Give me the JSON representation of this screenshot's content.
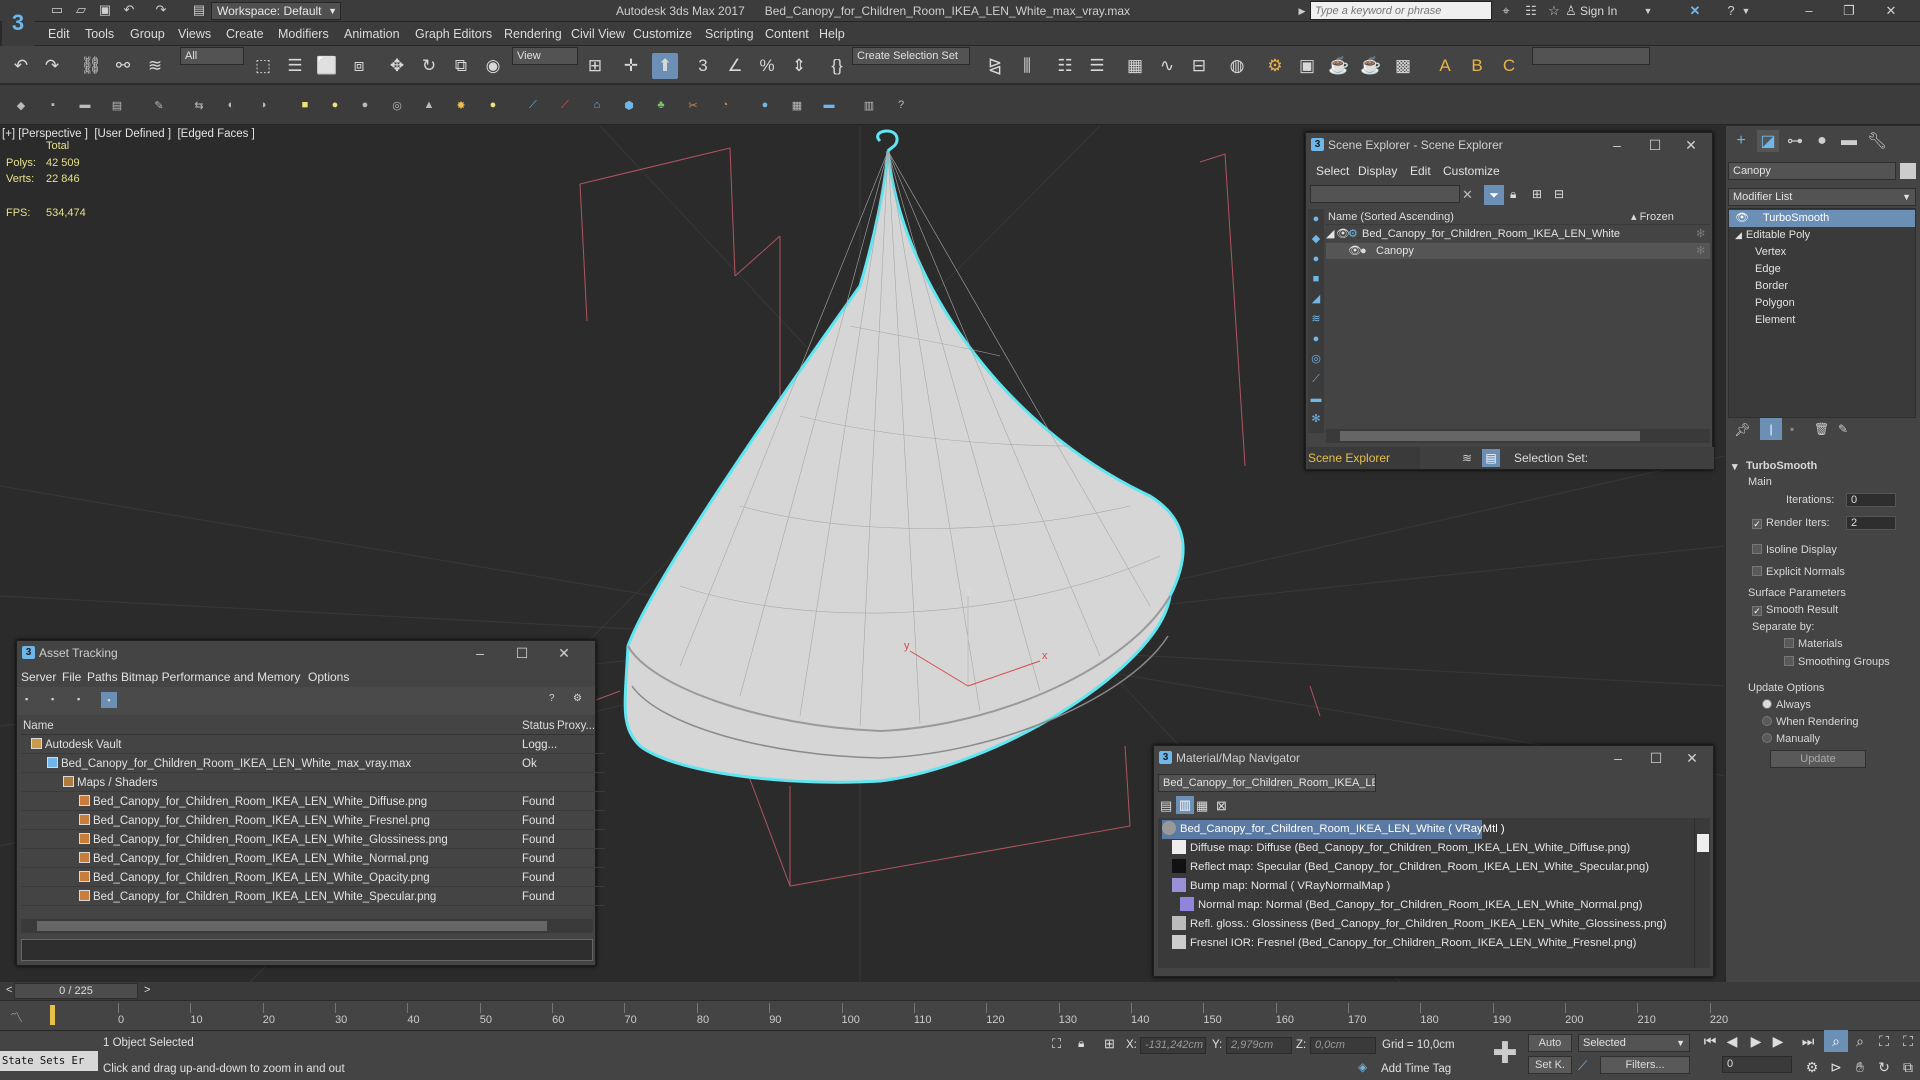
{
  "title_bar": {
    "logo": "3",
    "workspace_label": "Workspace: Default",
    "app_title": "Autodesk 3ds Max 2017      Bed_Canopy_for_Children_Room_IKEA_LEN_White_max_vray.max",
    "search_placeholder": "Type a keyword or phrase",
    "sign_in": "Sign In"
  },
  "menu": [
    "Edit",
    "Tools",
    "Group",
    "Views",
    "Create",
    "Modifiers",
    "Animation",
    "Graph Editors",
    "Rendering",
    "Civil View",
    "Customize",
    "Scripting",
    "Content",
    "Help"
  ],
  "toolbar": {
    "filter_all": "All",
    "ref_coord": "View",
    "selection_set": "Create Selection Set"
  },
  "viewport": {
    "label": "[+] [Perspective ]  [User Defined ]  [Edged Faces ]",
    "stats_total": "Total",
    "polys_label": "Polys:",
    "polys_value": "42 509",
    "verts_label": "Verts:",
    "verts_value": "22 846",
    "fps_label": "FPS:",
    "fps_value": "534,474",
    "axis_x": "x",
    "axis_y": "y",
    "axis_z": "z"
  },
  "scene_explorer": {
    "title": "Scene Explorer - Scene Explorer",
    "menu": [
      "Select",
      "Display",
      "Edit",
      "Customize"
    ],
    "col_name": "Name (Sorted Ascending)",
    "col_frozen": "▴ Frozen",
    "root": "Bed_Canopy_for_Children_Room_IKEA_LEN_White",
    "child": "Canopy",
    "footer_name": "Scene Explorer",
    "selection_set": "Selection Set:"
  },
  "command_panel": {
    "object_name": "Canopy",
    "modifier_list": "Modifier List",
    "stack": [
      "TurboSmooth",
      "Editable Poly",
      "Vertex",
      "Edge",
      "Border",
      "Polygon",
      "Element"
    ],
    "rollout_title": "TurboSmooth",
    "main": "Main",
    "iterations_label": "Iterations:",
    "iterations_value": "0",
    "render_iters_label": "Render Iters:",
    "render_iters_value": "2",
    "isoline": "Isoline Display",
    "explicit_normals": "Explicit Normals",
    "surface_params": "Surface Parameters",
    "smooth_result": "Smooth Result",
    "separate_by": "Separate by:",
    "materials": "Materials",
    "smoothing_groups": "Smoothing Groups",
    "update_options": "Update Options",
    "always": "Always",
    "when_rendering": "When Rendering",
    "manually": "Manually",
    "update_button": "Update"
  },
  "asset_tracking": {
    "title": "Asset Tracking",
    "menu": [
      "Server",
      "File",
      "Paths",
      "Bitmap Performance and Memory",
      "Options"
    ],
    "col_name": "Name",
    "col_status": "Status",
    "col_proxy": "Proxy...",
    "rows": [
      {
        "name": "Autodesk Vault",
        "status": "Logg..."
      },
      {
        "name": "Bed_Canopy_for_Children_Room_IKEA_LEN_White_max_vray.max",
        "status": "Ok"
      },
      {
        "name": "Maps / Shaders",
        "status": ""
      },
      {
        "name": "Bed_Canopy_for_Children_Room_IKEA_LEN_White_Diffuse.png",
        "status": "Found"
      },
      {
        "name": "Bed_Canopy_for_Children_Room_IKEA_LEN_White_Fresnel.png",
        "status": "Found"
      },
      {
        "name": "Bed_Canopy_for_Children_Room_IKEA_LEN_White_Glossiness.png",
        "status": "Found"
      },
      {
        "name": "Bed_Canopy_for_Children_Room_IKEA_LEN_White_Normal.png",
        "status": "Found"
      },
      {
        "name": "Bed_Canopy_for_Children_Room_IKEA_LEN_White_Opacity.png",
        "status": "Found"
      },
      {
        "name": "Bed_Canopy_for_Children_Room_IKEA_LEN_White_Specular.png",
        "status": "Found"
      }
    ]
  },
  "material_navigator": {
    "title": "Material/Map Navigator",
    "field": "Bed_Canopy_for_Children_Room_IKEA_LEN_W",
    "rows": [
      "Bed_Canopy_for_Children_Room_IKEA_LEN_White  ( VRayMtl )",
      "Diffuse map: Diffuse (Bed_Canopy_for_Children_Room_IKEA_LEN_White_Diffuse.png)",
      "Reflect map: Specular (Bed_Canopy_for_Children_Room_IKEA_LEN_White_Specular.png)",
      "Bump map: Normal  ( VRayNormalMap )",
      "Normal map: Normal (Bed_Canopy_for_Children_Room_IKEA_LEN_White_Normal.png)",
      "Refl. gloss.: Glossiness (Bed_Canopy_for_Children_Room_IKEA_LEN_White_Glossiness.png)",
      "Fresnel IOR: Fresnel (Bed_Canopy_for_Children_Room_IKEA_LEN_White_Fresnel.png)"
    ]
  },
  "timeline": {
    "frame": "0 / 225",
    "ticks": [
      "0",
      "10",
      "20",
      "30",
      "40",
      "50",
      "60",
      "70",
      "80",
      "90",
      "100",
      "110",
      "120",
      "130",
      "140",
      "150",
      "160",
      "170",
      "180",
      "190",
      "200",
      "210",
      "220"
    ]
  },
  "status": {
    "state_sets": "State Sets Er",
    "selected": "1 Object Selected",
    "prompt": "Click and drag up-and-down to zoom in and out",
    "x_label": "X:",
    "x_value": "-131,242cm",
    "y_label": "Y:",
    "y_value": "2,979cm",
    "z_label": "Z:",
    "z_value": "0,0cm",
    "grid": "Grid = 10,0cm",
    "add_time_tag": "Add Time Tag",
    "auto": "Auto",
    "set_k": "Set K.",
    "selected_dd": "Selected",
    "filters": "Filters...",
    "frame_field": "0"
  }
}
